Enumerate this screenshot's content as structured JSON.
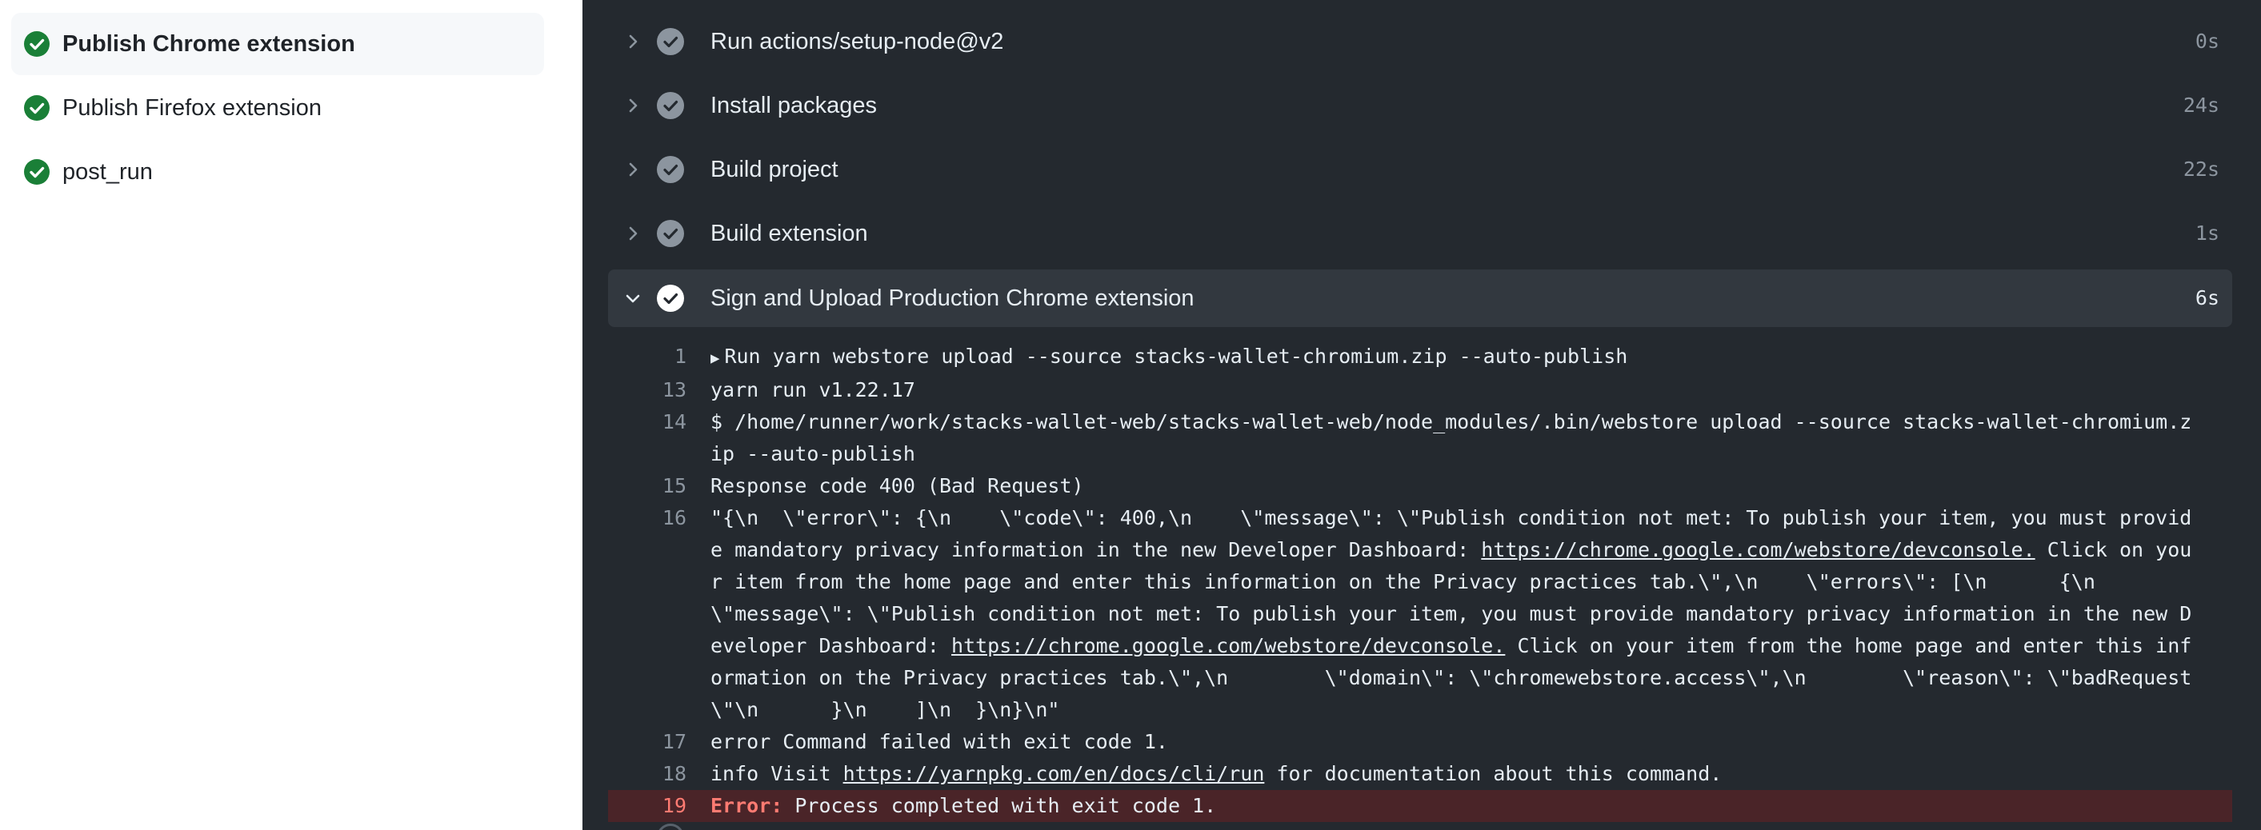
{
  "sidebar": {
    "jobs": [
      {
        "label": "Publish Chrome extension",
        "status": "success",
        "active": true
      },
      {
        "label": "Publish Firefox extension",
        "status": "success",
        "active": false
      },
      {
        "label": "post_run",
        "status": "success",
        "active": false
      }
    ]
  },
  "steps": [
    {
      "name": "Run actions/setup-node@v2",
      "duration": "0s"
    },
    {
      "name": "Install packages",
      "duration": "24s"
    },
    {
      "name": "Build project",
      "duration": "22s"
    },
    {
      "name": "Build extension",
      "duration": "1s"
    },
    {
      "name": "Sign and Upload Production Chrome extension",
      "duration": "6s",
      "expanded": true
    }
  ],
  "log": {
    "l1": {
      "num": "1",
      "text": "Run yarn webstore upload --source stacks-wallet-chromium.zip --auto-publish"
    },
    "l13": {
      "num": "13",
      "text": "yarn run v1.22.17"
    },
    "l14": {
      "num": "14",
      "text": "$ /home/runner/work/stacks-wallet-web/stacks-wallet-web/node_modules/.bin/webstore upload --source stacks-wallet-chromium.zip --auto-publish"
    },
    "l15": {
      "num": "15",
      "text": "Response code 400 (Bad Request)"
    },
    "l16": {
      "num": "16",
      "t1": "\"{\\n  \\\"error\\\": {\\n    \\\"code\\\": 400,\\n    \\\"message\\\": \\\"Publish condition not met: To publish your item, you must provide mandatory privacy information in the new Developer Dashboard: ",
      "link1": "https://chrome.google.com/webstore/devconsole.",
      "t2": " Click on your item from the home page and enter this information on the Privacy practices tab.\\\",\\n    \\\"errors\\\": [\\n      {\\n        \\\"message\\\": \\\"Publish condition not met: To publish your item, you must provide mandatory privacy information in the new Developer Dashboard: ",
      "link2": "https://chrome.google.com/webstore/devconsole.",
      "t3": " Click on your item from the home page and enter this information on the Privacy practices tab.\\\",\\n        \\\"domain\\\": \\\"chromewebstore.access\\\",\\n        \\\"reason\\\": \\\"badRequest\\\"\\n      }\\n    ]\\n  }\\n}\\n\""
    },
    "l17": {
      "num": "17",
      "text": "error Command failed with exit code 1."
    },
    "l18": {
      "num": "18",
      "t1": "info Visit ",
      "link": "https://yarnpkg.com/en/docs/cli/run",
      "t2": " for documentation about this command."
    },
    "l19": {
      "num": "19",
      "label": "Error:",
      "text": " Process completed with exit code 1."
    }
  },
  "colors": {
    "success": "#1a7f37",
    "error": "#ff7b72",
    "panel_bg": "#24292f"
  }
}
